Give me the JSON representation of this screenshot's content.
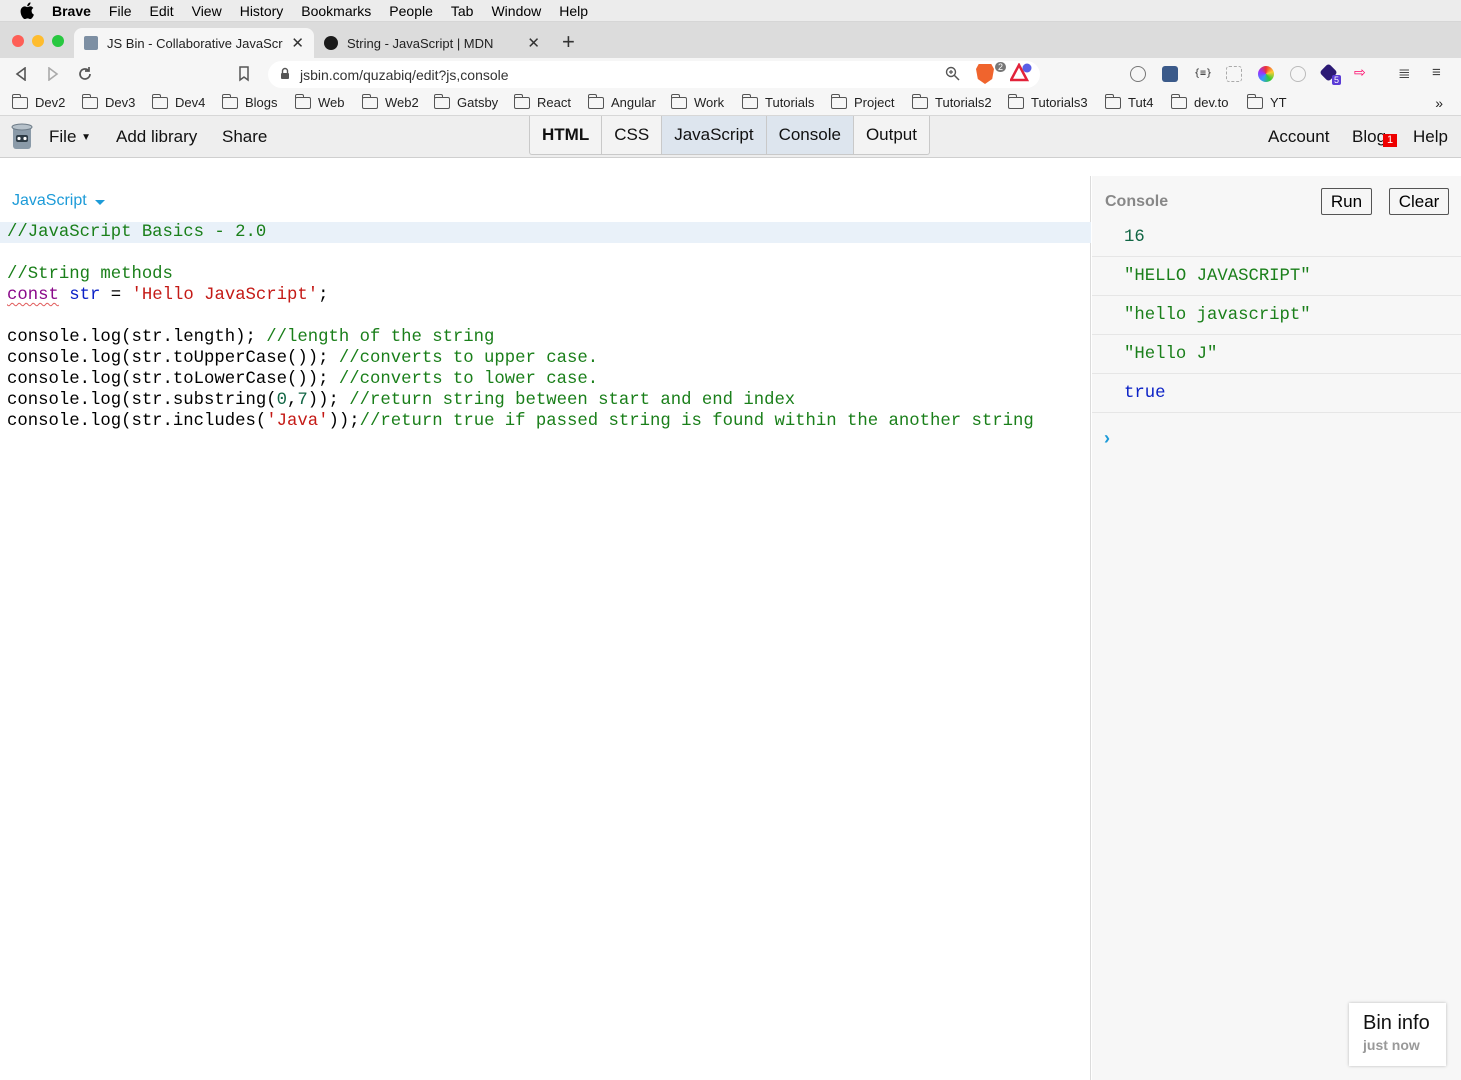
{
  "menubar": {
    "app": "Brave",
    "items": [
      "File",
      "Edit",
      "View",
      "History",
      "Bookmarks",
      "People",
      "Tab",
      "Window",
      "Help"
    ]
  },
  "tabs": [
    {
      "title": "JS Bin - Collaborative JavaScript Debugging",
      "active": true
    },
    {
      "title": "String - JavaScript | MDN",
      "active": false
    }
  ],
  "urlbar": {
    "url": "jsbin.com/quzabiq/edit?js,console"
  },
  "extensions": {
    "brave_count": "2",
    "ext_badge": "5"
  },
  "bookmarks": [
    "Dev2",
    "Dev3",
    "Dev4",
    "Blogs",
    "Web",
    "Web2",
    "Gatsby",
    "React",
    "Angular",
    "Work",
    "Tutorials",
    "Project",
    "Tutorials2",
    "Tutorials3",
    "Tut4",
    "dev.to",
    "YT"
  ],
  "jsbin": {
    "file": "File",
    "add_library": "Add library",
    "share": "Share",
    "panels": [
      "HTML",
      "CSS",
      "JavaScript",
      "Console",
      "Output"
    ],
    "account": "Account",
    "blog": "Blog",
    "blog_badge": "1",
    "help": "Help"
  },
  "editor": {
    "language": "JavaScript",
    "lines": [
      "//JavaScript Basics - 2.0",
      "",
      "//String methods",
      "const str = 'Hello JavaScript';",
      "",
      "console.log(str.length); //length of the string",
      "console.log(str.toUpperCase()); //converts to upper case.",
      "console.log(str.toLowerCase()); //converts to lower case.",
      "console.log(str.substring(0,7)); //return string between start and end index",
      "console.log(str.includes('Java'));//return true if passed string is found within the another string"
    ]
  },
  "console": {
    "title": "Console",
    "run": "Run",
    "clear": "Clear",
    "output": [
      "16",
      "\"HELLO JAVASCRIPT\"",
      "\"hello javascript\"",
      "\"Hello J\"",
      "true"
    ],
    "prompt": "›"
  },
  "bininfo": {
    "title": "Bin info",
    "subtitle": "just now"
  }
}
